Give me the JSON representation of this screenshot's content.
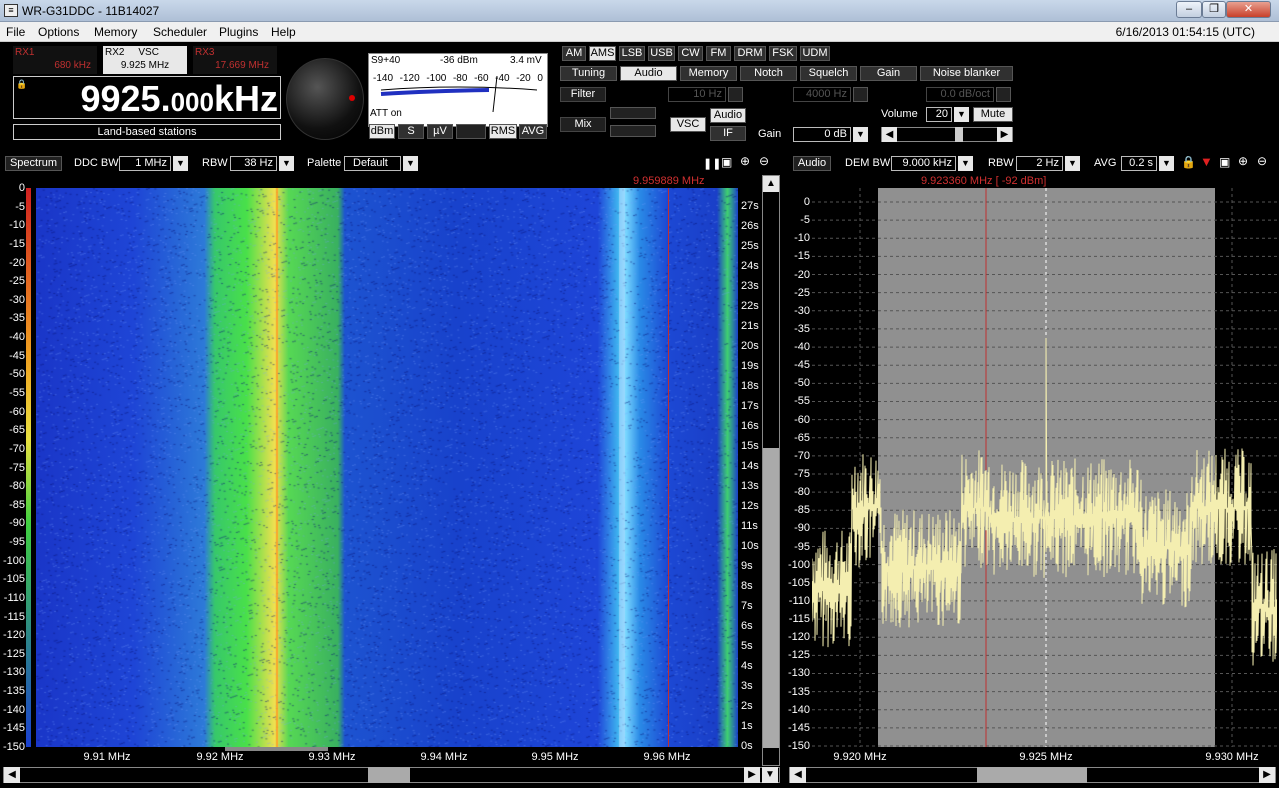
{
  "window": {
    "title": "WR-G31DDC - 11B14027",
    "buttons": [
      "–",
      "❐",
      "✕"
    ]
  },
  "menu": [
    "File",
    "Options",
    "Memory",
    "Scheduler",
    "Plugins",
    "Help"
  ],
  "datetime": "6/16/2013 01:54:15 (UTC)",
  "receivers": [
    {
      "name": "RX1",
      "freq": "680 kHz",
      "active": false
    },
    {
      "name": "RX2",
      "vsc": "VSC",
      "freq": "9.925 MHz",
      "active": true
    },
    {
      "name": "RX3",
      "freq": "17.669 MHz",
      "active": false
    }
  ],
  "frequency": {
    "main": "9925.",
    "small": "000",
    "unit": "kHz"
  },
  "band_label": "Land-based stations",
  "smeter": {
    "s_reading": "S9+40",
    "dbm": "-36 dBm",
    "mv": "3.4 mV",
    "scale": [
      "-140",
      "-120",
      "-100",
      "-80",
      "-60",
      "-40",
      "-20",
      "0"
    ],
    "att": "ATT on",
    "units": [
      "dBm",
      "S",
      "µV",
      ""
    ],
    "rms": "RMS",
    "avg": "AVG"
  },
  "modes": [
    "AM",
    "AMS",
    "LSB",
    "USB",
    "CW",
    "FM",
    "DRM",
    "FSK",
    "UDM"
  ],
  "selected_mode": "AMS",
  "tabs": [
    "Tuning",
    "Audio",
    "Memory",
    "Notch",
    "Squelch",
    "Gain",
    "Noise blanker"
  ],
  "selected_tab": "Audio",
  "audio": {
    "filter": "Filter",
    "mix": "Mix",
    "filter_val": "10 Hz",
    "squelch_val": "4000 Hz",
    "db_oct": "0.0 dB/oct",
    "vsc": "VSC",
    "audio": "Audio",
    "if": "IF",
    "gain_label": "Gain",
    "gain_val": "0 dB",
    "volume_label": "Volume",
    "volume_val": "20",
    "mute": "Mute"
  },
  "left_panel": {
    "spectrum_btn": "Spectrum",
    "ddc_label": "DDC BW",
    "ddc_val": "1 MHz",
    "rbw_label": "RBW",
    "rbw_val": "38 Hz",
    "palette_label": "Palette",
    "palette_val": "Default",
    "marker": "9.959889 MHz",
    "y_ticks": [
      "0",
      "-5",
      "-10",
      "-15",
      "-20",
      "-25",
      "-30",
      "-35",
      "-40",
      "-45",
      "-50",
      "-55",
      "-60",
      "-65",
      "-70",
      "-75",
      "-80",
      "-85",
      "-90",
      "-95",
      "-100",
      "-105",
      "-110",
      "-115",
      "-120",
      "-125",
      "-130",
      "-135",
      "-140",
      "-145",
      "-150"
    ],
    "time_ticks": [
      "27s",
      "26s",
      "25s",
      "24s",
      "23s",
      "22s",
      "21s",
      "20s",
      "19s",
      "18s",
      "17s",
      "16s",
      "15s",
      "14s",
      "13s",
      "12s",
      "11s",
      "10s",
      "9s",
      "8s",
      "7s",
      "6s",
      "5s",
      "4s",
      "3s",
      "2s",
      "1s",
      "0s"
    ],
    "x_ticks": [
      "9.91 MHz",
      "9.92 MHz",
      "9.93 MHz",
      "9.94 MHz",
      "9.95 MHz",
      "9.96 MHz"
    ]
  },
  "right_panel": {
    "audio_btn": "Audio",
    "dem_label": "DEM BW",
    "dem_val": "9.000 kHz",
    "rbw_label": "RBW",
    "rbw_val": "2 Hz",
    "avg_label": "AVG",
    "avg_val": "0.2 s",
    "marker": "9.923360 MHz [  -92 dBm]",
    "y_ticks": [
      "0",
      "-5",
      "-10",
      "-15",
      "-20",
      "-25",
      "-30",
      "-35",
      "-40",
      "-45",
      "-50",
      "-55",
      "-60",
      "-65",
      "-70",
      "-75",
      "-80",
      "-85",
      "-90",
      "-95",
      "-100",
      "-105",
      "-110",
      "-115",
      "-120",
      "-125",
      "-130",
      "-135",
      "-140",
      "-145",
      "-150"
    ],
    "x_ticks": [
      "9.920 MHz",
      "9.925 MHz",
      "9.930 MHz"
    ]
  },
  "colors": {
    "title_bg": "#c9d8ea",
    "menu_bg": "#f0f0f0",
    "spectrum_trace": "#f4eeb0",
    "filter_band": "#909090",
    "marker_red": "#c03030",
    "text_red": "#d03030"
  }
}
